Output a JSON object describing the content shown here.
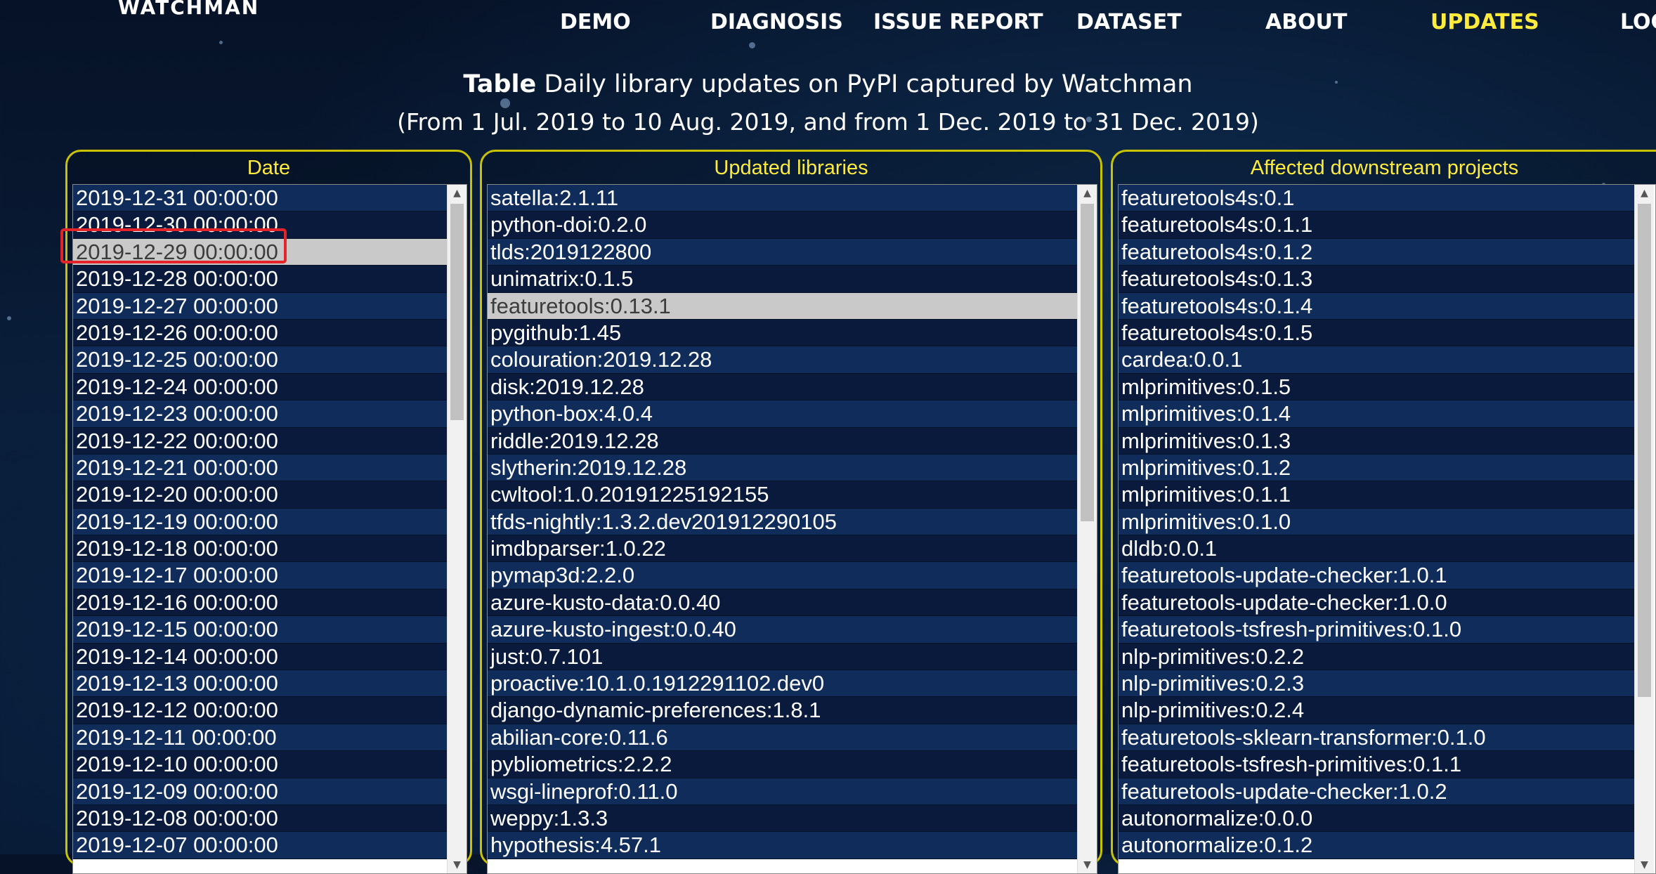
{
  "nav": {
    "logo": "WATCHMAN",
    "items": [
      "DEMO",
      "DIAGNOSIS",
      "ISSUE REPORT",
      "DATASET",
      "ABOUT",
      "UPDATES",
      "LOG"
    ],
    "active": "UPDATES"
  },
  "caption": {
    "bold": "Table",
    "title": " Daily library updates on PyPI captured by Watchman",
    "subtitle": "(From 1 Jul. 2019 to 10 Aug. 2019, and from 1 Dec. 2019 to 31 Dec. 2019)"
  },
  "colors": {
    "accent": "#ffeb3b",
    "panel_border": "#c8c200",
    "highlight": "#e3242b",
    "selected_row": "#c9c9c9"
  },
  "date_panel": {
    "title": "Date",
    "selected": "2019-12-29 00:00:00",
    "rows": [
      "2019-12-31 00:00:00",
      "2019-12-30 00:00:00",
      "2019-12-29 00:00:00",
      "2019-12-28 00:00:00",
      "2019-12-27 00:00:00",
      "2019-12-26 00:00:00",
      "2019-12-25 00:00:00",
      "2019-12-24 00:00:00",
      "2019-12-23 00:00:00",
      "2019-12-22 00:00:00",
      "2019-12-21 00:00:00",
      "2019-12-20 00:00:00",
      "2019-12-19 00:00:00",
      "2019-12-18 00:00:00",
      "2019-12-17 00:00:00",
      "2019-12-16 00:00:00",
      "2019-12-15 00:00:00",
      "2019-12-14 00:00:00",
      "2019-12-13 00:00:00",
      "2019-12-12 00:00:00",
      "2019-12-11 00:00:00",
      "2019-12-10 00:00:00",
      "2019-12-09 00:00:00",
      "2019-12-08 00:00:00",
      "2019-12-07 00:00:00"
    ]
  },
  "libraries_panel": {
    "title": "Updated libraries",
    "selected": "featuretools:0.13.1",
    "rows": [
      "satella:2.1.11",
      "python-doi:0.2.0",
      "tlds:2019122800",
      "unimatrix:0.1.5",
      "featuretools:0.13.1",
      "pygithub:1.45",
      "colouration:2019.12.28",
      "disk:2019.12.28",
      "python-box:4.0.4",
      "riddle:2019.12.28",
      "slytherin:2019.12.28",
      "cwltool:1.0.20191225192155",
      "tfds-nightly:1.3.2.dev201912290105",
      "imdbparser:1.0.22",
      "pymap3d:2.2.0",
      "azure-kusto-data:0.0.40",
      "azure-kusto-ingest:0.0.40",
      "just:0.7.101",
      "proactive:10.1.0.1912291102.dev0",
      "django-dynamic-preferences:1.8.1",
      "abilian-core:0.11.6",
      "pybliometrics:2.2.2",
      "wsgi-lineprof:0.11.0",
      "weppy:1.3.3",
      "hypothesis:4.57.1"
    ]
  },
  "downstream_panel": {
    "title": "Affected downstream projects",
    "rows": [
      "featuretools4s:0.1",
      "featuretools4s:0.1.1",
      "featuretools4s:0.1.2",
      "featuretools4s:0.1.3",
      "featuretools4s:0.1.4",
      "featuretools4s:0.1.5",
      "cardea:0.0.1",
      "mlprimitives:0.1.5",
      "mlprimitives:0.1.4",
      "mlprimitives:0.1.3",
      "mlprimitives:0.1.2",
      "mlprimitives:0.1.1",
      "mlprimitives:0.1.0",
      "dldb:0.0.1",
      "featuretools-update-checker:1.0.1",
      "featuretools-update-checker:1.0.0",
      "featuretools-tsfresh-primitives:0.1.0",
      "nlp-primitives:0.2.2",
      "nlp-primitives:0.2.3",
      "nlp-primitives:0.2.4",
      "featuretools-sklearn-transformer:0.1.0",
      "featuretools-tsfresh-primitives:0.1.1",
      "featuretools-update-checker:1.0.2",
      "autonormalize:0.0.0",
      "autonormalize:0.1.2"
    ]
  }
}
